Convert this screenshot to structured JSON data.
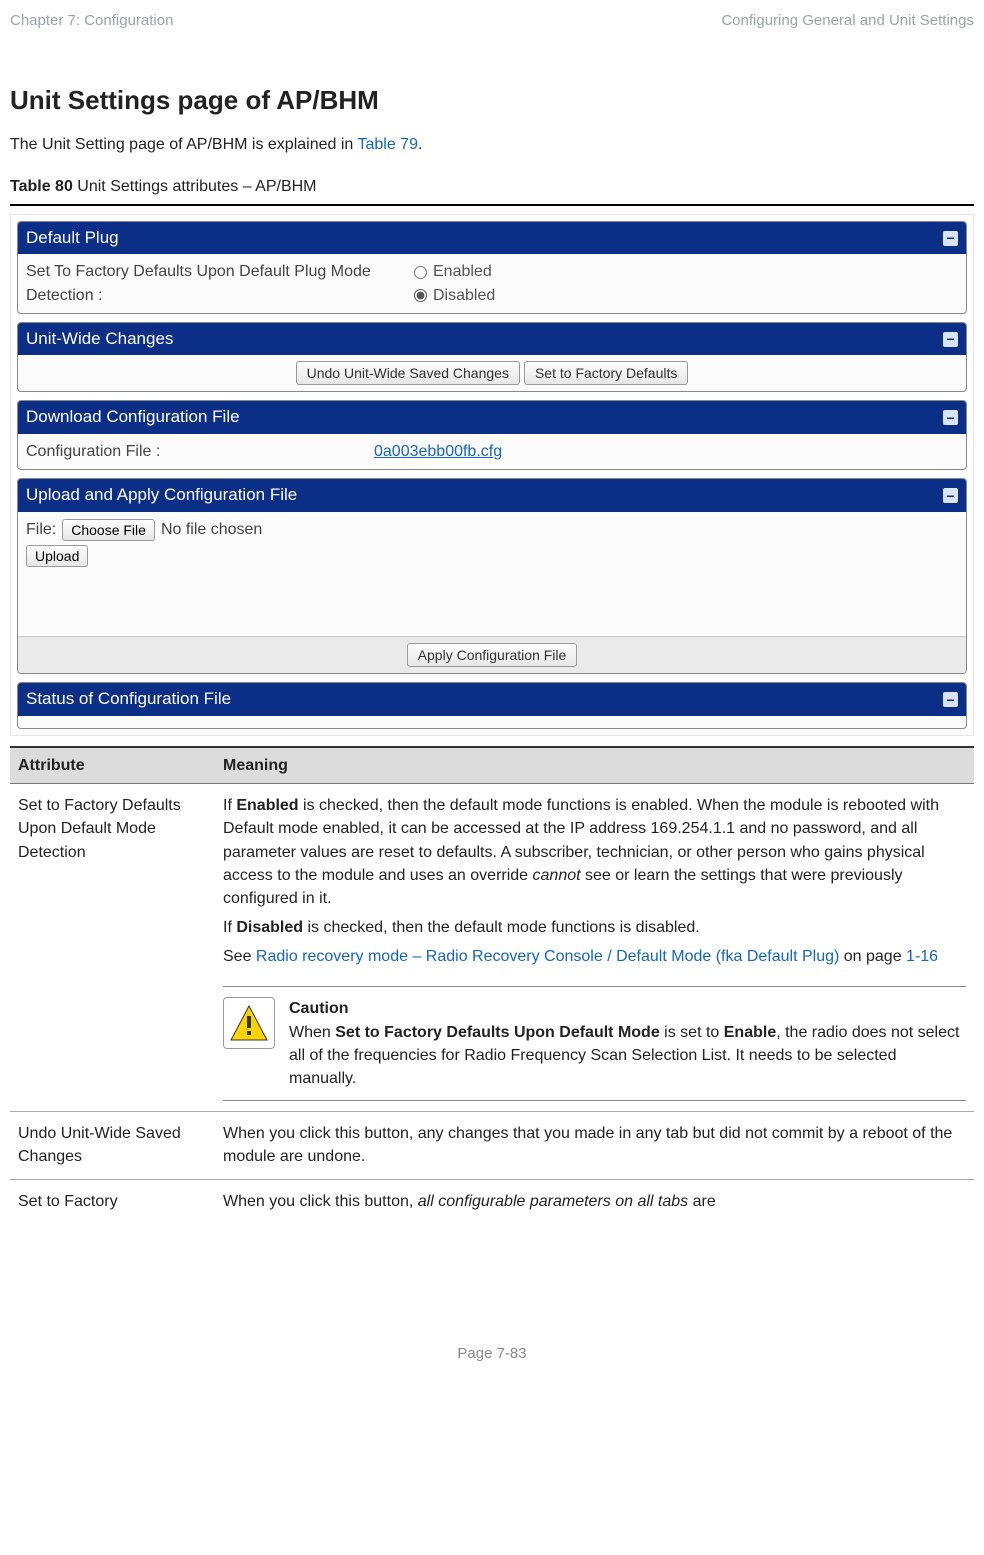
{
  "header": {
    "left": "Chapter 7:  Configuration",
    "right": "Configuring General and Unit Settings"
  },
  "heading": "Unit Settings page of AP/BHM",
  "intro": {
    "before_link": "The Unit Setting page of AP/BHM is explained in ",
    "link": "Table 79",
    "after_link": "."
  },
  "table_caption": {
    "bold": "Table 80",
    "rest": " Unit Settings attributes – AP/BHM"
  },
  "screenshot": {
    "panels": {
      "default_plug": {
        "title": "Default Plug",
        "row_label": "Set To Factory Defaults Upon Default Plug Mode Detection :",
        "opt_enabled": "Enabled",
        "opt_disabled": "Disabled"
      },
      "unit_wide": {
        "title": "Unit-Wide Changes",
        "btn_undo": "Undo Unit-Wide Saved Changes",
        "btn_factory": "Set to Factory Defaults"
      },
      "download": {
        "title": "Download Configuration File",
        "label": "Configuration File :",
        "file_link": "0a003ebb00fb.cfg"
      },
      "upload": {
        "title": "Upload and Apply Configuration File",
        "file_label": "File:",
        "choose_btn": "Choose File",
        "no_file": "No file chosen",
        "upload_btn": "Upload",
        "apply_btn": "Apply Configuration File"
      },
      "status": {
        "title": "Status of Configuration File"
      }
    }
  },
  "attr_table": {
    "head": {
      "attribute": "Attribute",
      "meaning": "Meaning"
    },
    "rows": {
      "r1": {
        "name": "Set to Factory Defaults Upon Default Mode Detection",
        "p1a": "If ",
        "p1b": "Enabled",
        "p1c": " is checked, then the default mode functions is enabled. When the module is rebooted with Default mode enabled, it can be accessed at the IP address 169.254.1.1 and no password, and all parameter values are reset to defaults. A subscriber, technician, or other person who gains physical access to the module and uses an override ",
        "p1_italic": "cannot",
        "p1d": " see or learn the settings that were previously configured in it.",
        "p2a": "If ",
        "p2b": "Disabled",
        "p2c": " is checked, then the default mode functions is disabled.",
        "p3a": "See ",
        "p3_link": "Radio recovery mode – Radio Recovery Console / Default Mode (fka Default Plug)",
        "p3b": " on page ",
        "p3_page": "1-16",
        "caution": {
          "title": "Caution",
          "t1": "When ",
          "t2": "Set to Factory Defaults Upon Default Mode",
          "t3": " is set to ",
          "t4": "Enable",
          "t5": ", the radio does not select all of the frequencies for Radio Frequency Scan Selection List. It needs to be selected manually."
        }
      },
      "r2": {
        "name": "Undo Unit-Wide Saved Changes",
        "text": "When you click this button, any changes that you made in any tab but did not commit by a reboot of the module are undone."
      },
      "r3": {
        "name": "Set to Factory",
        "t1": "When you click this button, ",
        "t2": "all configurable parameters on all tabs",
        "t3": " are"
      }
    }
  },
  "footer": "Page 7-83"
}
